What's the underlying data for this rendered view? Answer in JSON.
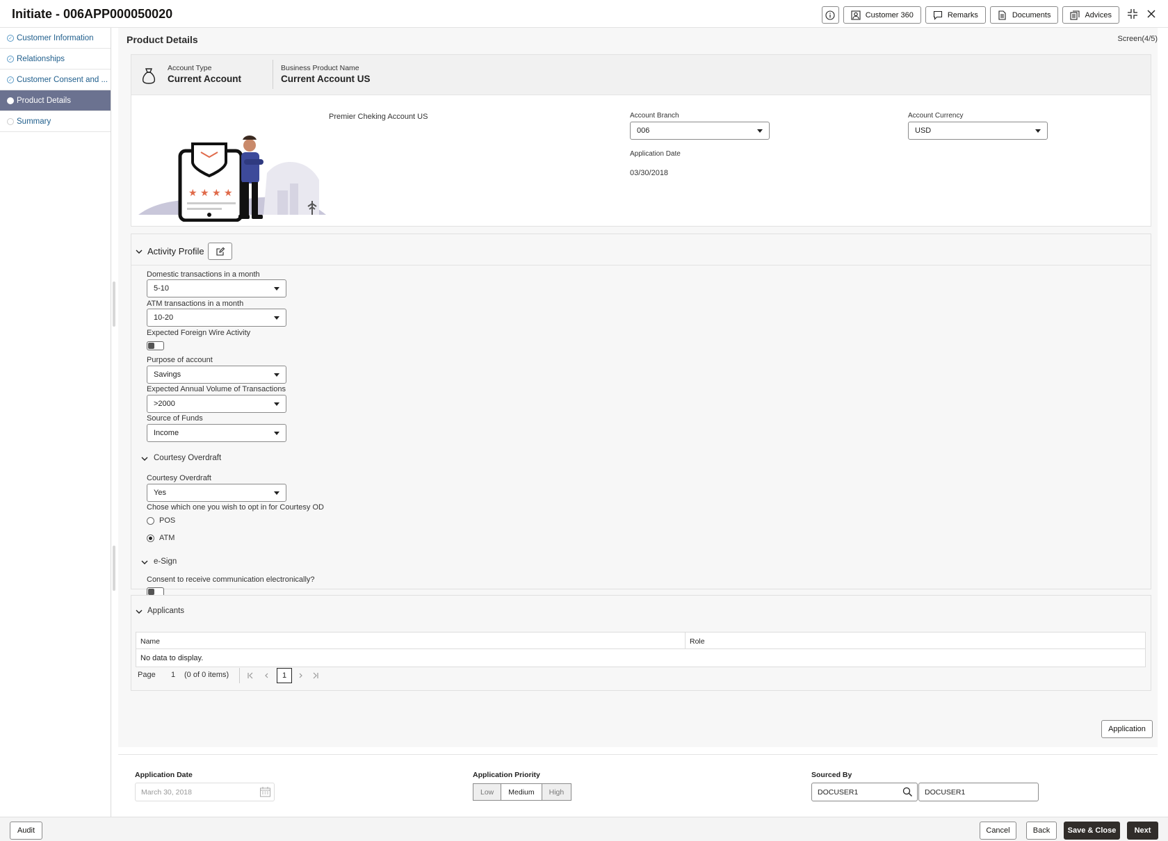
{
  "header": {
    "title": "Initiate - 006APP000050020",
    "buttons": {
      "customer360": "Customer 360",
      "remarks": "Remarks",
      "documents": "Documents",
      "advices": "Advices"
    }
  },
  "sidebar": {
    "items": [
      {
        "label": "Customer Information"
      },
      {
        "label": "Relationships"
      },
      {
        "label": "Customer Consent and ..."
      },
      {
        "label": "Product Details"
      },
      {
        "label": "Summary"
      }
    ]
  },
  "main": {
    "page_title": "Product Details",
    "screen_indicator": "Screen(4/5)",
    "product": {
      "account_type_label": "Account Type",
      "account_type_value": "Current Account",
      "business_product_label": "Business Product Name",
      "business_product_value": "Current Account US",
      "product_name": "Premier Cheking Account US",
      "account_branch_label": "Account Branch",
      "account_branch_value": "006",
      "account_currency_label": "Account Currency",
      "account_currency_value": "USD",
      "application_date_label": "Application Date",
      "application_date_value": "03/30/2018"
    },
    "activity_profile": {
      "title": "Activity Profile",
      "domestic_label": "Domestic transactions in a month",
      "domestic_value": "5-10",
      "atm_label": "ATM transactions in a month",
      "atm_value": "10-20",
      "foreign_wire_label": "Expected Foreign Wire Activity",
      "purpose_label": "Purpose of account",
      "purpose_value": "Savings",
      "annual_volume_label": "Expected Annual Volume of Transactions",
      "annual_volume_value": ">2000",
      "source_label": "Source of Funds",
      "source_value": "Income",
      "courtesy_section": "Courtesy Overdraft",
      "courtesy_label": "Courtesy Overdraft",
      "courtesy_value": "Yes",
      "opt_in_label": "Chose which one you wish to opt in for Courtesy OD",
      "opt_pos": "POS",
      "opt_atm": "ATM",
      "esign_section": "e-Sign",
      "consent_label": "Consent to receive communication electronically?"
    },
    "applicants": {
      "title": "Applicants",
      "columns": [
        "Name",
        "Role"
      ],
      "empty_text": "No data to display.",
      "page_label": "Page",
      "page_number": "1",
      "items_text": "(0 of 0 items)",
      "current_page": "1"
    },
    "application_button": "Application"
  },
  "footer_form": {
    "application_date_label": "Application Date",
    "application_date_value": "March 30, 2018",
    "priority_label": "Application Priority",
    "priority_options": [
      "Low",
      "Medium",
      "High"
    ],
    "sourced_by_label": "Sourced By",
    "sourced_by_value": "DOCUSER1",
    "sourced_by_name": "DOCUSER1"
  },
  "bottom_bar": {
    "audit": "Audit",
    "cancel": "Cancel",
    "back": "Back",
    "save_close": "Save & Close",
    "next": "Next"
  }
}
